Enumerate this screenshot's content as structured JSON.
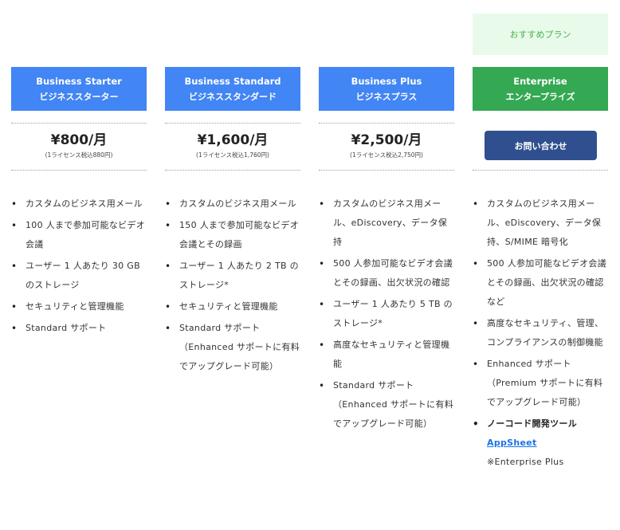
{
  "recommend_label": "おすすめプラン",
  "plans": [
    {
      "name_en": "Business Starter",
      "name_ja": "ビジネススターター",
      "price": "¥800/月",
      "price_note": "(1ライセンス税込880円)",
      "features": [
        "カスタムのビジネス用メール",
        "100 人まで参加可能なビデオ会議",
        "ユーザー 1 人あたり 30 GB のストレージ",
        "セキュリティと管理機能",
        "Standard サポート"
      ]
    },
    {
      "name_en": "Business Standard",
      "name_ja": "ビジネススタンダード",
      "price": "¥1,600/月",
      "price_note": "(1ライセンス税込1,760円)",
      "features": [
        "カスタムのビジネス用メール",
        "150 人まで参加可能なビデオ会議とその録画",
        "ユーザー 1 人あたり 2 TB のストレージ*",
        "セキュリティと管理機能",
        "Standard サポート（Enhanced サポートに有料でアップグレード可能）"
      ]
    },
    {
      "name_en": "Business Plus",
      "name_ja": "ビジネスプラス",
      "price": "¥2,500/月",
      "price_note": "(1ライセンス税込2,750円)",
      "features": [
        "カスタムのビジネス用メール、eDiscovery、データ保持",
        "500 人参加可能なビデオ会議とその録画、出欠状況の確認",
        "ユーザー 1 人あたり 5 TB のストレージ*",
        "高度なセキュリティと管理機能",
        "Standard サポート（Enhanced サポートに有料でアップグレード可能）"
      ]
    },
    {
      "name_en": "Enterprise",
      "name_ja": "エンタープライズ",
      "contact_label": "お問い合わせ",
      "features": [
        "カスタムのビジネス用メール、eDiscovery、データ保持、S/MIME 暗号化",
        "500 人参加可能なビデオ会議とその録画、出欠状況の確認など",
        "高度なセキュリティ、管理、コンプライアンスの制御機能",
        "Enhanced サポート（Premium サポートに有料でアップグレード可能）",
        "ノーコード開発ツール"
      ],
      "link_label": "AppSheet",
      "note": "※Enterprise Plus"
    }
  ]
}
